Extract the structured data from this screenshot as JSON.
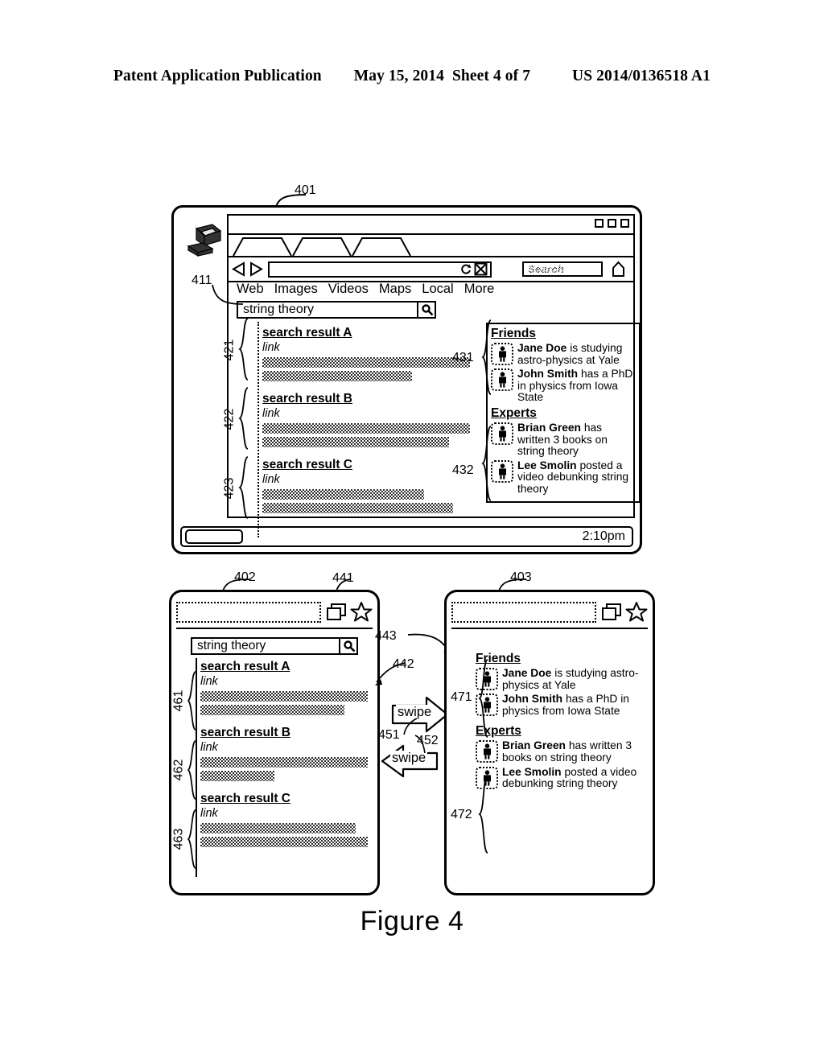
{
  "publication_header": {
    "left": "Patent Application Publication",
    "date": "May 15, 2014",
    "sheet": "Sheet 4 of 7",
    "patent_number": "US 2014/0136518 A1"
  },
  "figure": {
    "caption": "Figure 4"
  },
  "ref_numbers": {
    "desktop_window": "401",
    "search_box_411": "411",
    "result_a": "421",
    "result_b": "422",
    "result_c": "423",
    "friends_panel": "431",
    "experts_panel": "432",
    "phone_left": "402",
    "phone_right": "403",
    "tabs_icon": "441",
    "leader_442": "442",
    "leader_443": "443",
    "swipe_right": "451",
    "swipe_left": "452",
    "m_result_a": "461",
    "m_result_b": "462",
    "m_result_c": "463",
    "m_friends": "471",
    "m_experts": "472"
  },
  "desktop": {
    "icons": {
      "computer": "computer-icon",
      "back": "back-arrow-icon",
      "forward": "forward-arrow-icon",
      "reload": "reload-icon",
      "stop": "stop-icon",
      "home": "home-icon",
      "magnifier": "magnifier-icon"
    },
    "window_buttons": [
      "minimize",
      "maximize",
      "close"
    ],
    "tab_count": 3,
    "url_value": "",
    "browser_search": {
      "placeholder": "Search",
      "value": ""
    },
    "nav_links": [
      "Web",
      "Images",
      "Videos",
      "Maps",
      "Local",
      "More"
    ],
    "site_search": {
      "value": "string theory",
      "placeholder": ""
    },
    "results": [
      {
        "title": "search result A",
        "link": "link",
        "bars": [
          100,
          72
        ]
      },
      {
        "title": "search result B",
        "link": "link",
        "bars": [
          100,
          90
        ]
      },
      {
        "title": "search result C",
        "link": "link",
        "bars": [
          78,
          92
        ]
      }
    ],
    "social": [
      {
        "heading": "Friends",
        "items": [
          {
            "name": "Jane Doe",
            "text": " is studying astro-physics at Yale"
          },
          {
            "name": "John Smith",
            "text": " has a PhD in physics from Iowa State"
          }
        ]
      },
      {
        "heading": "Experts",
        "items": [
          {
            "name": "Brian Green",
            "text": " has written 3 books on string theory"
          },
          {
            "name": "Lee Smolin",
            "text": " posted a video debunking string theory"
          }
        ]
      }
    ],
    "taskbar": {
      "start_label": "",
      "clock": "2:10pm"
    }
  },
  "phone_left": {
    "url_value": "",
    "icons": {
      "tabs": "tabs-icon",
      "star": "star-icon",
      "magnifier": "magnifier-icon"
    },
    "site_search": {
      "value": "string theory",
      "placeholder": ""
    },
    "results": [
      {
        "title": "search result A",
        "link": "link",
        "bars": [
          100,
          86
        ]
      },
      {
        "title": "search result B",
        "link": "link",
        "bars": [
          100,
          44
        ]
      },
      {
        "title": "search result C",
        "link": "link",
        "bars": [
          93,
          100
        ]
      }
    ]
  },
  "phone_right": {
    "url_value": "",
    "icons": {
      "tabs": "tabs-icon",
      "star": "star-icon"
    },
    "social": [
      {
        "heading": "Friends",
        "items": [
          {
            "name": "Jane Doe",
            "text": " is studying astro-physics at Yale"
          },
          {
            "name": "John Smith",
            "text": " has a PhD in physics from Iowa State"
          }
        ]
      },
      {
        "heading": "Experts",
        "items": [
          {
            "name": "Brian Green",
            "text": " has written 3 books on string theory"
          },
          {
            "name": "Lee Smolin",
            "text": " posted a video debunking string theory"
          }
        ]
      }
    ]
  },
  "gestures": {
    "swipe_right_label": "swipe",
    "swipe_left_label": "swipe"
  }
}
